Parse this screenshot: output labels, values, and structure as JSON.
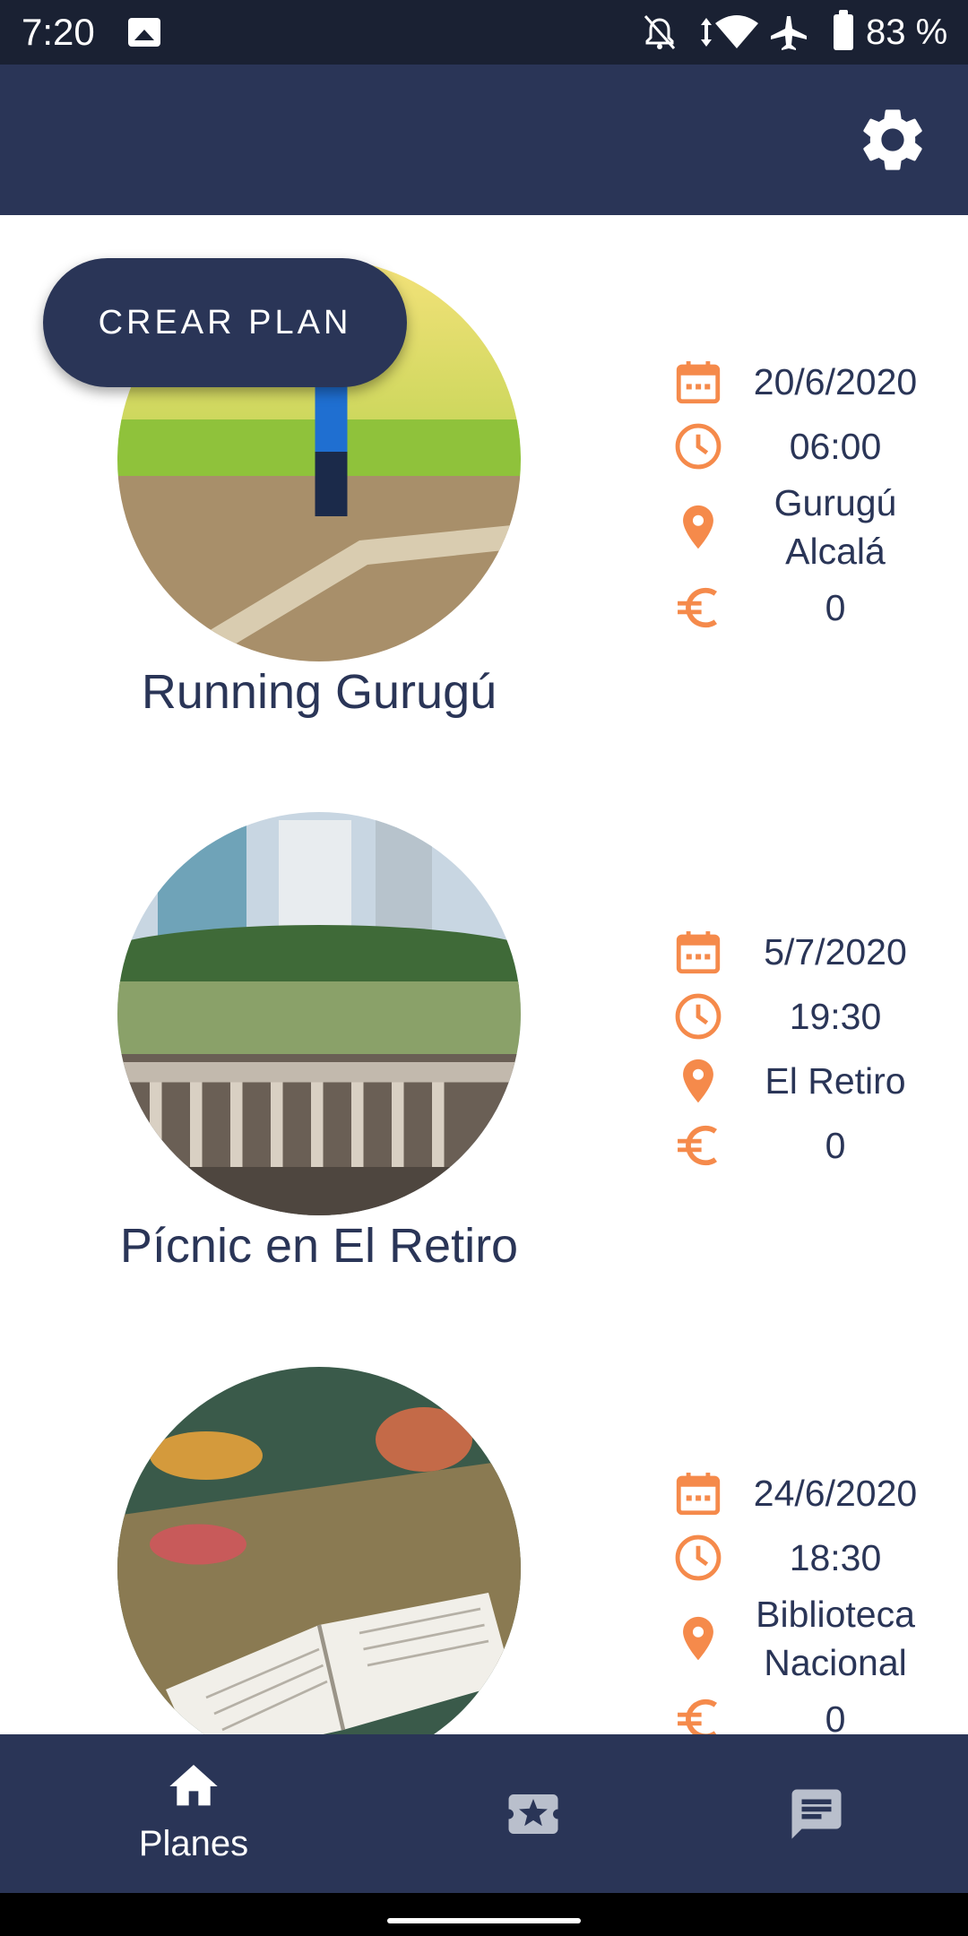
{
  "status_bar": {
    "time": "7:20",
    "battery_percent": "83 %"
  },
  "header": {
    "settings_icon": "gear-icon"
  },
  "fab": {
    "label": "CREAR PLAN"
  },
  "plans": [
    {
      "title": "Running Gurugú",
      "date": "20/6/2020",
      "time": "06:00",
      "location": "Gurugú Alcalá",
      "price": "0",
      "image": "runner-on-track"
    },
    {
      "title": "Pícnic en El Retiro",
      "date": "5/7/2020",
      "time": "19:30",
      "location": "El Retiro",
      "price": "0",
      "image": "city-park-picnic"
    },
    {
      "title": "",
      "date": "24/6/2020",
      "time": "18:30",
      "location": "Biblioteca Nacional",
      "price": "0",
      "image": "open-book-on-bench"
    }
  ],
  "bottom_nav": {
    "items": [
      {
        "label": "Planes",
        "icon": "home-icon",
        "active": true
      },
      {
        "label": "",
        "icon": "ticket-star-icon",
        "active": false
      },
      {
        "label": "",
        "icon": "chat-icon",
        "active": false
      }
    ]
  },
  "colors": {
    "primary": "#2a3557",
    "accent": "#f58a4b",
    "status_bar": "#1a2133"
  }
}
